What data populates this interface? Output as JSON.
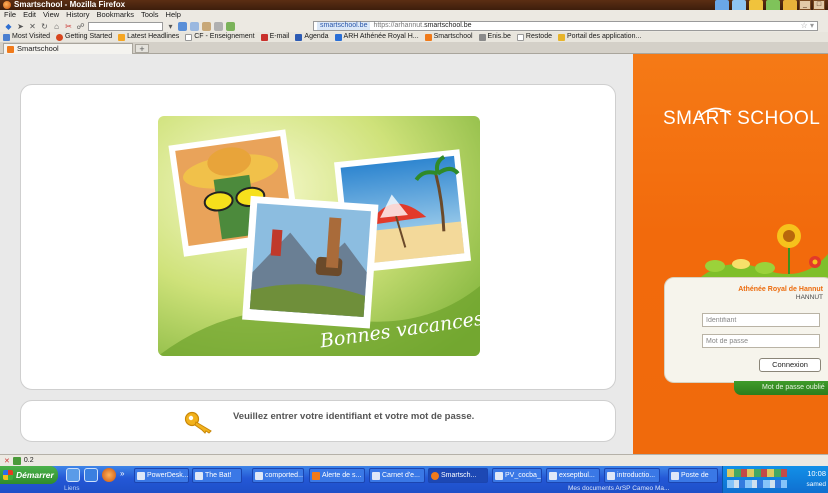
{
  "window": {
    "title": "Smartschool - Mozilla Firefox"
  },
  "menu": [
    "File",
    "Edit",
    "View",
    "History",
    "Bookmarks",
    "Tools",
    "Help"
  ],
  "address": {
    "site": "smartschool.be",
    "url_prefix": "https://arhannut.",
    "url_domain": "smartschool.be"
  },
  "bookmarks": [
    {
      "label": "Most Visited",
      "color": "#4a7fd0"
    },
    {
      "label": "Getting Started",
      "color": "#d8451c"
    },
    {
      "label": "Latest Headlines",
      "color": "#f5a623"
    },
    {
      "label": "CF - Enseignement",
      "color": "#e0e0e0"
    },
    {
      "label": "E-mail",
      "color": "#c9302c"
    },
    {
      "label": "Agenda",
      "color": "#2d5bb4"
    },
    {
      "label": "ARH Athénée Royal H...",
      "color": "#2a6fd6"
    },
    {
      "label": "Smartschool",
      "color": "#f07a1a"
    },
    {
      "label": "Enis.be",
      "color": "#8a8a8a"
    },
    {
      "label": "Restode",
      "color": "#e8e8e8"
    },
    {
      "label": "Portail des application...",
      "color": "#e7b42b"
    }
  ],
  "tabs": {
    "active_tab": "Smartschool",
    "new_tab": "+"
  },
  "illustration": {
    "caption": "Bonnes vacances"
  },
  "message": {
    "text": "Veuillez entrer votre identifiant et votre mot de passe."
  },
  "brand": {
    "logo_text": "SMART SCHOOL",
    "color": "#f26a0c"
  },
  "login": {
    "school_name": "Athénée Royal de Hannut",
    "school_city": "HANNUT",
    "username_placeholder": "Identifiant",
    "password_placeholder": "Mot de passe",
    "submit_label": "Connexion",
    "forgot_label": "Mot de passe oublié"
  },
  "statusbar": {
    "text": "0.2"
  },
  "taskbar": {
    "start_label": "Démarrer",
    "tasks": [
      "PowerDesk...",
      "The Bat!",
      "comported...",
      "Alerte de s...",
      "Carnet d'e...",
      "Smartsch...",
      "PV_cocba_...",
      "exseptbul...",
      "introductio..."
    ],
    "right_task": "Poste de",
    "clock": "10:08",
    "day": "samed",
    "sub_left": "Liens",
    "sub_mid": "Mes documents   ArSP Cameo Ma..."
  }
}
